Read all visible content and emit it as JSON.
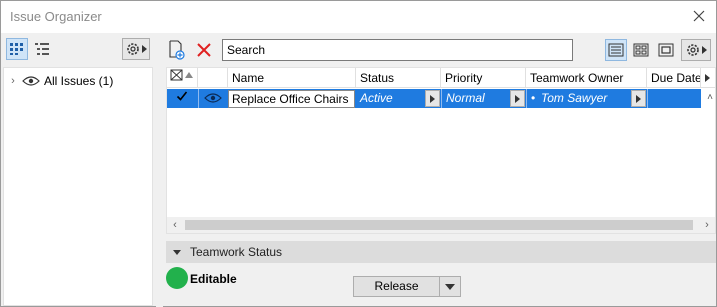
{
  "window": {
    "title": "Issue Organizer"
  },
  "search": {
    "placeholder": "Search"
  },
  "tree": {
    "items": [
      {
        "label": "All Issues (1)"
      }
    ]
  },
  "table": {
    "columns": [
      "Name",
      "Status",
      "Priority",
      "Teamwork Owner",
      "Due Date"
    ],
    "rows": [
      {
        "name": "Replace Office Chairs",
        "status": "Active",
        "priority": "Normal",
        "owner": "Tom Sawyer",
        "due_date": "",
        "visible": true,
        "checked": true
      }
    ]
  },
  "teamwork": {
    "section_title": "Teamwork Status",
    "status_label": "Editable",
    "status_color": "#22b14c",
    "release_label": "Release"
  },
  "colors": {
    "selection": "#1f7be0",
    "toolbar_active": "#cfe4f8",
    "delete_red": "#e02020"
  }
}
